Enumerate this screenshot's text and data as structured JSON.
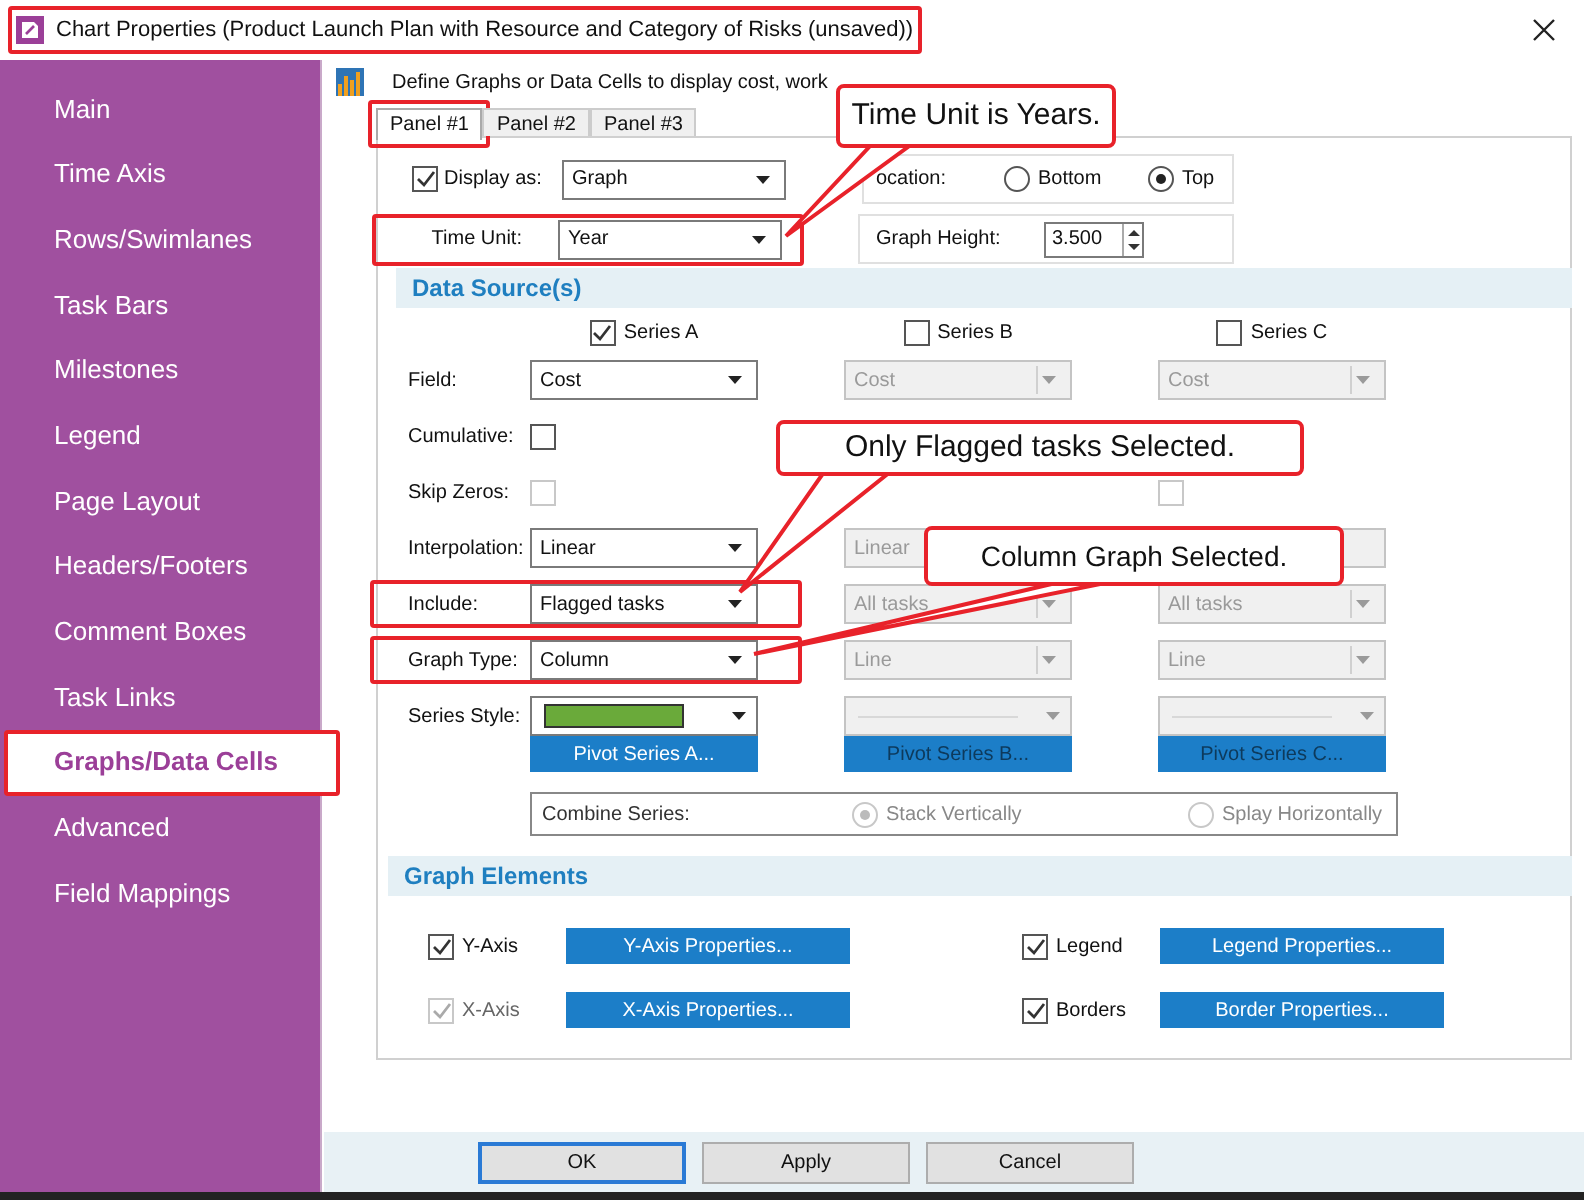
{
  "window": {
    "title": "Chart Properties (Product Launch Plan with Resource and Category of Risks (unsaved))",
    "highlighted": true
  },
  "sidebar": {
    "items": [
      {
        "label": "Main",
        "selected": false,
        "highlighted": false
      },
      {
        "label": "Time Axis",
        "selected": false,
        "highlighted": false
      },
      {
        "label": "Rows/Swimlanes",
        "selected": false,
        "highlighted": false
      },
      {
        "label": "Task Bars",
        "selected": false,
        "highlighted": false
      },
      {
        "label": "Milestones",
        "selected": false,
        "highlighted": false
      },
      {
        "label": "Legend",
        "selected": false,
        "highlighted": false
      },
      {
        "label": "Page Layout",
        "selected": false,
        "highlighted": false
      },
      {
        "label": "Headers/Footers",
        "selected": false,
        "highlighted": false
      },
      {
        "label": "Comment Boxes",
        "selected": false,
        "highlighted": false
      },
      {
        "label": "Task Links",
        "selected": false,
        "highlighted": false
      },
      {
        "label": "Graphs/Data Cells",
        "selected": true,
        "highlighted": true
      },
      {
        "label": "Advanced",
        "selected": false,
        "highlighted": false
      },
      {
        "label": "Field Mappings",
        "selected": false,
        "highlighted": false
      }
    ]
  },
  "intro": "Define Graphs or Data Cells to display cost, work",
  "tabs": [
    {
      "label": "Panel #1",
      "selected": true,
      "highlighted": true
    },
    {
      "label": "Panel #2",
      "selected": false,
      "highlighted": false
    },
    {
      "label": "Panel #3",
      "selected": false,
      "highlighted": false
    }
  ],
  "display_as": {
    "label": "Display as:",
    "checked": true,
    "value": "Graph"
  },
  "location": {
    "label": "ocation:",
    "options": [
      {
        "label": "Bottom",
        "selected": false
      },
      {
        "label": "Top",
        "selected": true
      }
    ]
  },
  "time_unit": {
    "label": "Time Unit:",
    "value": "Year",
    "highlighted": true
  },
  "graph_height": {
    "label": "Graph Height:",
    "value": "3.500"
  },
  "data_source": {
    "title": "Data Source(s)",
    "series": [
      {
        "label": "Series A",
        "checked": true
      },
      {
        "label": "Series B",
        "checked": false
      },
      {
        "label": "Series C",
        "checked": false
      }
    ],
    "rows": [
      {
        "kind": "dropdown",
        "label": "Field:",
        "highlighted": false,
        "cells": [
          {
            "value": "Cost",
            "disabled": false
          },
          {
            "value": "Cost",
            "disabled": true
          },
          {
            "value": "Cost",
            "disabled": true
          }
        ]
      },
      {
        "kind": "checkbox",
        "label": "Cumulative:",
        "highlighted": false,
        "cells": [
          {
            "checked": false,
            "disabled": false
          },
          null,
          null
        ]
      },
      {
        "kind": "checkbox",
        "label": "Skip Zeros:",
        "highlighted": false,
        "cells": [
          {
            "checked": false,
            "disabled": true
          },
          null,
          {
            "checked": false,
            "disabled": true
          }
        ]
      },
      {
        "kind": "dropdown",
        "label": "Interpolation:",
        "highlighted": false,
        "cells": [
          {
            "value": "Linear",
            "disabled": false
          },
          {
            "value": "Linear",
            "disabled": true
          },
          {
            "disabled": true
          }
        ]
      },
      {
        "kind": "dropdown",
        "label": "Include:",
        "highlighted": true,
        "cells": [
          {
            "value": "Flagged tasks",
            "disabled": false
          },
          {
            "value": "All tasks",
            "disabled": true
          },
          {
            "value": "All tasks",
            "disabled": true
          }
        ]
      },
      {
        "kind": "dropdown",
        "label": "Graph Type:",
        "highlighted": true,
        "cells": [
          {
            "value": "Column",
            "disabled": false
          },
          {
            "value": "Line",
            "disabled": true
          },
          {
            "value": "Line",
            "disabled": true
          }
        ]
      },
      {
        "kind": "style",
        "label": "Series Style:",
        "highlighted": false,
        "cells": [
          {
            "color": "#6aaa3a",
            "disabled": false
          },
          {
            "disabled": true
          },
          {
            "disabled": true
          }
        ]
      }
    ],
    "pivot_buttons": [
      {
        "label": "Pivot Series A...",
        "disabled": false
      },
      {
        "label": "Pivot Series B...",
        "disabled": true
      },
      {
        "label": "Pivot Series C...",
        "disabled": true
      }
    ],
    "combine": {
      "label": "Combine Series:",
      "options": [
        {
          "label": "Stack Vertically",
          "selected": true
        },
        {
          "label": "Splay Horizontally",
          "selected": false
        }
      ]
    }
  },
  "graph_elements": {
    "title": "Graph Elements",
    "items": [
      {
        "label": "Y-Axis",
        "checked": true,
        "disabled": false,
        "button": "Y-Axis Properties..."
      },
      {
        "label": "Legend",
        "checked": true,
        "disabled": false,
        "button": "Legend Properties..."
      },
      {
        "label": "X-Axis",
        "checked": true,
        "disabled": true,
        "button": "X-Axis Properties..."
      },
      {
        "label": "Borders",
        "checked": true,
        "disabled": false,
        "button": "Border Properties..."
      }
    ]
  },
  "buttons": [
    {
      "label": "OK",
      "default": true
    },
    {
      "label": "Apply",
      "default": false
    },
    {
      "label": "Cancel",
      "default": false
    }
  ],
  "callouts": [
    {
      "text": "Time Unit is Years."
    },
    {
      "text": "Only Flagged tasks Selected."
    },
    {
      "text": "Column Graph Selected."
    }
  ]
}
